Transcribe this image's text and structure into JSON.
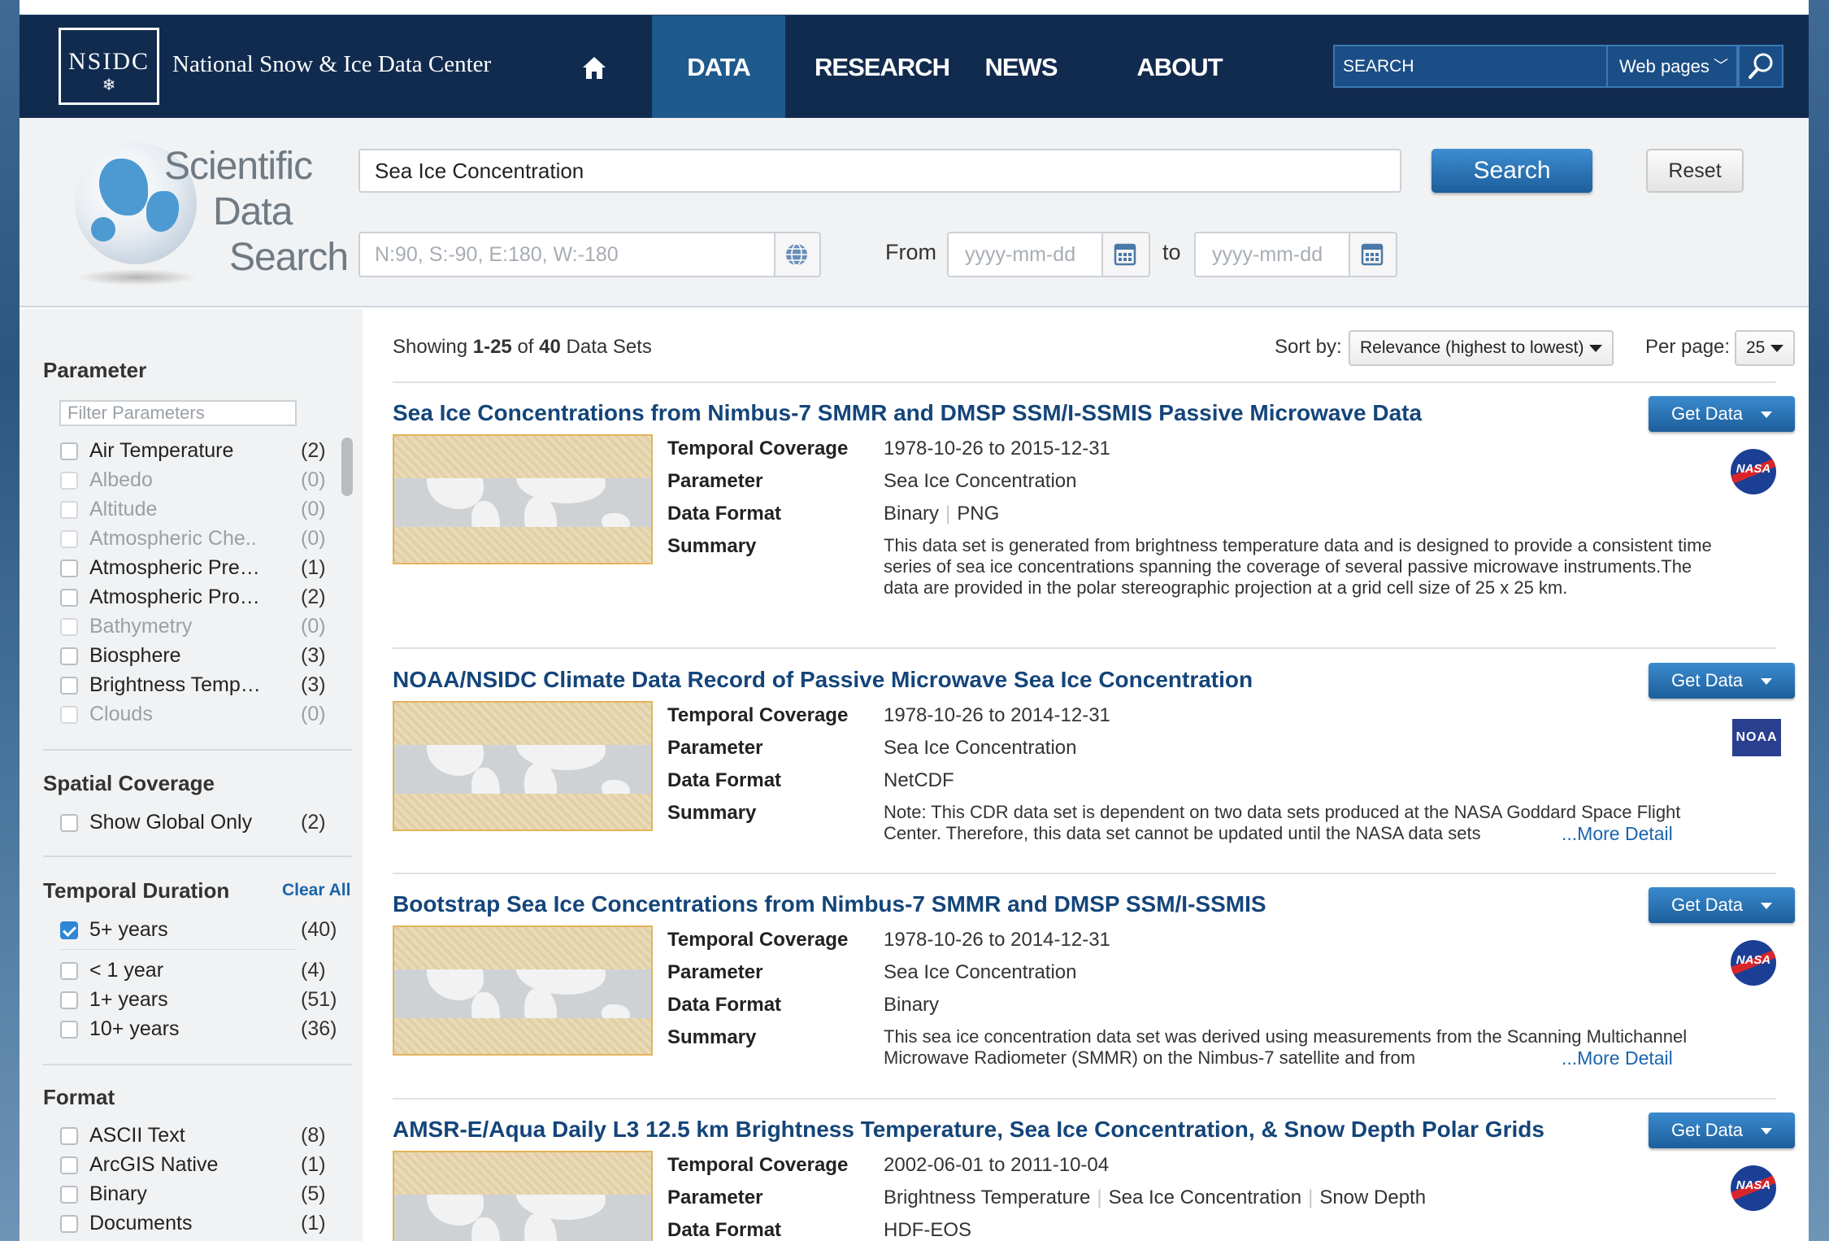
{
  "header": {
    "logo_abbr": "NSIDC",
    "org_name": "National Snow & Ice Data Center",
    "nav": [
      {
        "label": "DATA",
        "active": true
      },
      {
        "label": "RESEARCH"
      },
      {
        "label": "NEWS"
      },
      {
        "label": "ABOUT"
      }
    ],
    "search_placeholder": "SEARCH",
    "scope_select": "Web pages",
    "icons": [
      "home-icon",
      "magnifier-icon",
      "chevron-down-icon",
      "snowflake-icon"
    ]
  },
  "search": {
    "app_title": [
      "Scientific",
      "Data",
      "Search"
    ],
    "query": "Sea Ice Concentration",
    "search_button": "Search",
    "reset_button": "Reset",
    "bbox_placeholder": "N:90, S:-90, E:180, W:-180",
    "from_label": "From",
    "to_label": "to",
    "from_placeholder": "yyyy-mm-dd",
    "to_placeholder": "yyyy-mm-dd"
  },
  "facets": {
    "parameter": {
      "title": "Parameter",
      "filter_placeholder": "Filter Parameters",
      "items": [
        {
          "label": "Air Temperature",
          "count": "(2)",
          "disabled": false
        },
        {
          "label": "Albedo",
          "count": "(0)",
          "disabled": true
        },
        {
          "label": "Altitude",
          "count": "(0)",
          "disabled": true
        },
        {
          "label": "Atmospheric Che..",
          "count": "(0)",
          "disabled": true
        },
        {
          "label": "Atmospheric Pre…",
          "count": "(1)",
          "disabled": false
        },
        {
          "label": "Atmospheric Pro…",
          "count": "(2)",
          "disabled": false
        },
        {
          "label": "Bathymetry",
          "count": "(0)",
          "disabled": true
        },
        {
          "label": "Biosphere",
          "count": "(3)",
          "disabled": false
        },
        {
          "label": "Brightness Temp…",
          "count": "(3)",
          "disabled": false
        },
        {
          "label": "Clouds",
          "count": "(0)",
          "disabled": true
        }
      ]
    },
    "spatial": {
      "title": "Spatial Coverage",
      "items": [
        {
          "label": "Show Global Only",
          "count": "(2)"
        }
      ]
    },
    "temporal": {
      "title": "Temporal Duration",
      "clear_all": "Clear All",
      "selected": [
        {
          "label": "5+ years",
          "count": "(40)",
          "checked": true
        }
      ],
      "items": [
        {
          "label": "< 1 year",
          "count": "(4)"
        },
        {
          "label": "1+ years",
          "count": "(51)"
        },
        {
          "label": "10+ years",
          "count": "(36)"
        }
      ]
    },
    "format": {
      "title": "Format",
      "items": [
        {
          "label": "ASCII Text",
          "count": "(8)"
        },
        {
          "label": "ArcGIS Native",
          "count": "(1)"
        },
        {
          "label": "Binary",
          "count": "(5)"
        },
        {
          "label": "Documents",
          "count": "(1)"
        }
      ]
    }
  },
  "results_bar": {
    "showing_prefix": "Showing ",
    "range": "1-25",
    "of_word": " of ",
    "total": "40",
    "suffix": " Data Sets",
    "sort_label": "Sort by:",
    "sort_value": "Relevance (highest to lowest)",
    "perpage_label": "Per page:",
    "perpage_value": "25"
  },
  "labels": {
    "temporal": "Temporal Coverage",
    "parameter": "Parameter",
    "format": "Data Format",
    "summary": "Summary",
    "get_data": "Get Data",
    "more_detail": "...More Detail"
  },
  "results": [
    {
      "title": "Sea Ice Concentrations from Nimbus-7 SMMR and DMSP SSM/I-SSMIS Passive Microwave Data",
      "temporal": "1978-10-26 to 2015-12-31",
      "parameters": [
        "Sea Ice Concentration"
      ],
      "formats": [
        "Binary",
        "PNG"
      ],
      "summary": "This data set is generated from brightness temperature data and is designed to provide a consistent time series of sea ice concentrations spanning the coverage of several passive microwave instruments.The data are provided in the polar stereographic projection at a grid cell size of 25 x 25 km.",
      "agency_logo": "NASA"
    },
    {
      "title": "NOAA/NSIDC Climate Data Record of Passive Microwave Sea Ice Concentration",
      "temporal": "1978-10-26 to 2014-12-31",
      "parameters": [
        "Sea Ice Concentration"
      ],
      "formats": [
        "NetCDF"
      ],
      "summary": "Note: This CDR data set is dependent on two data sets produced at the NASA Goddard Space Flight Center. Therefore, this data set cannot be updated until the NASA data sets",
      "agency_logo": "NOAA"
    },
    {
      "title": "Bootstrap Sea Ice Concentrations from Nimbus-7 SMMR and DMSP SSM/I-SSMIS",
      "temporal": "1978-10-26 to 2014-12-31",
      "parameters": [
        "Sea Ice Concentration"
      ],
      "formats": [
        "Binary"
      ],
      "summary": "This sea ice concentration data set was derived using measurements from the Scanning Multichannel Microwave Radiometer (SMMR) on the Nimbus-7 satellite and from",
      "agency_logo": "NASA"
    },
    {
      "title": "AMSR-E/Aqua Daily L3 12.5 km Brightness Temperature, Sea Ice Concentration, & Snow Depth Polar Grids",
      "temporal": "2002-06-01 to 2011-10-04",
      "parameters": [
        "Brightness Temperature",
        "Sea Ice Concentration",
        "Snow Depth"
      ],
      "formats": [
        "HDF-EOS"
      ],
      "agency_logo": "NASA"
    }
  ],
  "colors": {
    "nav_bg": "#112b4f",
    "nav_active": "#1f5a8c",
    "title_link": "#14457a",
    "button_blue": "#1d5e9c",
    "checkbox_checked": "#2f86d6"
  }
}
